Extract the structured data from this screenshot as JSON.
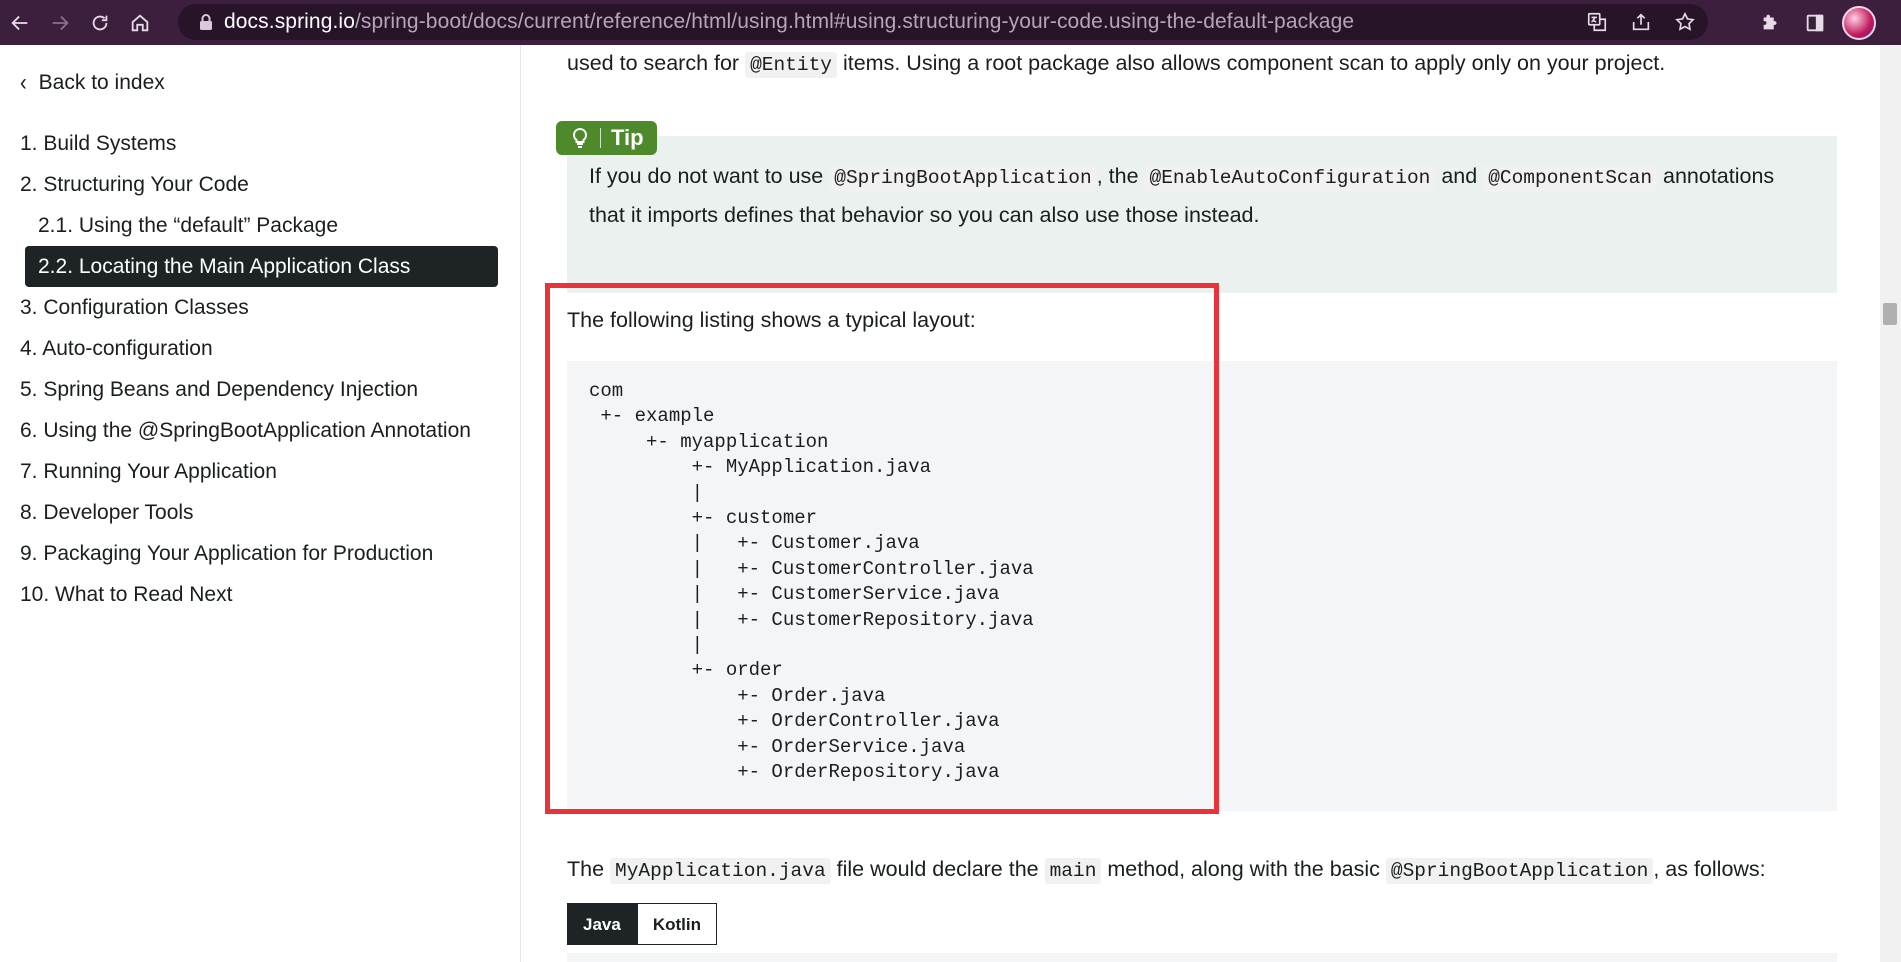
{
  "browser": {
    "url_host": "docs.spring.io",
    "url_path": "/spring-boot/docs/current/reference/html/using.html#using.structuring-your-code.using-the-default-package",
    "icons": [
      "back-icon",
      "forward-icon",
      "reload-icon",
      "home-icon",
      "lock-icon",
      "translate-icon",
      "share-icon",
      "star-icon",
      "extensions-icon",
      "sidebar-icon",
      "avatar"
    ]
  },
  "sidebar": {
    "back_label": "Back to index",
    "items": [
      {
        "label": "1. Build Systems"
      },
      {
        "label": "2. Structuring Your Code"
      },
      {
        "label": "2.1. Using the “default” Package"
      },
      {
        "label": "2.2. Locating the Main Application Class"
      },
      {
        "label": "3. Configuration Classes"
      },
      {
        "label": "4. Auto-configuration"
      },
      {
        "label": "5. Spring Beans and Dependency Injection"
      },
      {
        "label": "6. Using the @SpringBootApplication Annotation"
      },
      {
        "label": "7. Running Your Application"
      },
      {
        "label": "8. Developer Tools"
      },
      {
        "label": "9. Packaging Your Application for Production"
      },
      {
        "label": "10. What to Read Next"
      }
    ]
  },
  "content": {
    "line1_pre": "used to search for ",
    "line1_code": "@Entity",
    "line1_post": " items. Using a root package also allows component scan to apply only on your project.",
    "tip": {
      "label": "Tip",
      "t1": "If you do not want to use ",
      "c1": "@SpringBootApplication",
      "t2": ", the ",
      "c2": "@EnableAutoConfiguration",
      "t3": " and ",
      "c3": "@ComponentScan",
      "t4": " annotations",
      "t5": "that it imports defines that behavior so you can also use those instead."
    },
    "layout_intro": "The following listing shows a typical layout:",
    "listing": "com\n +- example\n     +- myapplication\n         +- MyApplication.java\n         |\n         +- customer\n         |   +- Customer.java\n         |   +- CustomerController.java\n         |   +- CustomerService.java\n         |   +- CustomerRepository.java\n         |\n         +- order\n             +- Order.java\n             +- OrderController.java\n             +- OrderService.java\n             +- OrderRepository.java",
    "declare": {
      "t1": "The ",
      "c1": "MyApplication.java",
      "t2": " file would declare the ",
      "c2": "main",
      "t3": " method, along with the basic ",
      "c3": "@SpringBootApplication",
      "t4": ", as follows:"
    },
    "tabs": [
      {
        "label": "Java",
        "active": true
      },
      {
        "label": "Kotlin",
        "active": false
      }
    ],
    "highlight_color": "#e8333a",
    "tip_color": "#4e8a2b"
  }
}
